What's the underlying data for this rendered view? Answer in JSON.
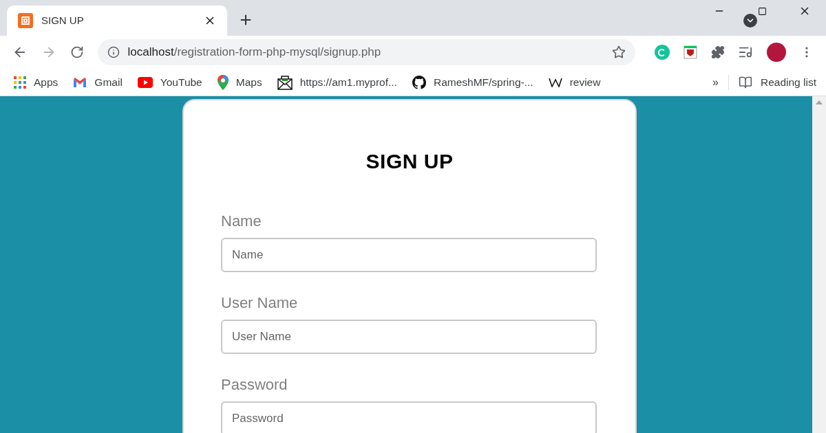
{
  "tab": {
    "title": "SIGN UP",
    "selected": true
  },
  "address_bar": {
    "host": "localhost",
    "path": "/registration-form-php-mysql/signup.php"
  },
  "bookmarks": [
    {
      "kind": "apps",
      "label": "Apps"
    },
    {
      "kind": "gmail",
      "label": "Gmail"
    },
    {
      "kind": "youtube",
      "label": "YouTube"
    },
    {
      "kind": "maps",
      "label": "Maps"
    },
    {
      "kind": "mail",
      "label": "https://am1.myprof..."
    },
    {
      "kind": "github",
      "label": "RameshMF/spring-..."
    },
    {
      "kind": "wiki",
      "label": "review"
    }
  ],
  "bookmarks_overflow": "»",
  "reading_list": "Reading list",
  "form": {
    "title": "SIGN UP",
    "fields": [
      {
        "label": "Name",
        "placeholder": "Name"
      },
      {
        "label": "User Name",
        "placeholder": "User Name"
      },
      {
        "label": "Password",
        "placeholder": "Password"
      }
    ]
  }
}
